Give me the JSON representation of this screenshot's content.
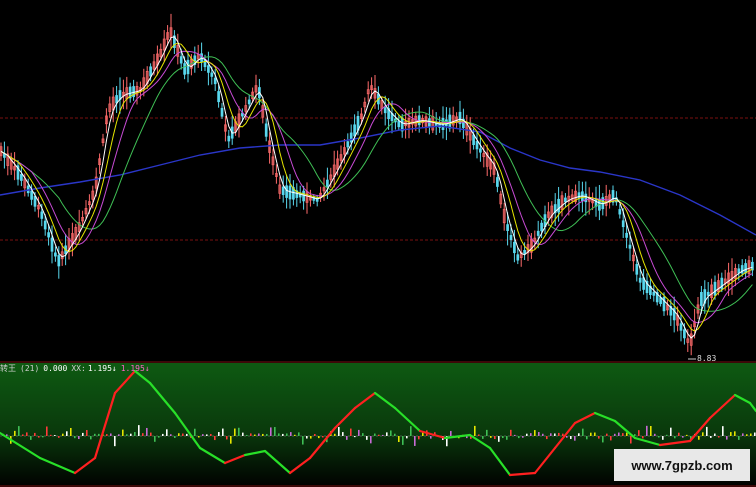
{
  "colors": {
    "background": "#000000",
    "candle": "#59d8ee",
    "candle_up": "#ff6b6b",
    "ma_short": "#ffffff",
    "ma_mid": "#e6e600",
    "ma_purple": "#c84bd6",
    "ma_green": "#3fbf55",
    "ma_long": "#2a36c8",
    "grid": "#7a1010",
    "indicator_bg_top": "#0c4a10",
    "indicator_bg_bottom": "#000000",
    "osc_up": "#ff2020",
    "osc_down": "#28e028",
    "header_text": "#d0d0d0",
    "header_value": "#ffffff"
  },
  "indicator": {
    "name": "转王",
    "param": "(21)",
    "value1": "0.000",
    "label2": "XX:",
    "value2": "1.195",
    "arrow2": "↓",
    "value3": "1.195",
    "arrow3": "↓"
  },
  "price_chart": {
    "low_marker": "8.83"
  },
  "watermark": "www.7gpzb.com"
}
